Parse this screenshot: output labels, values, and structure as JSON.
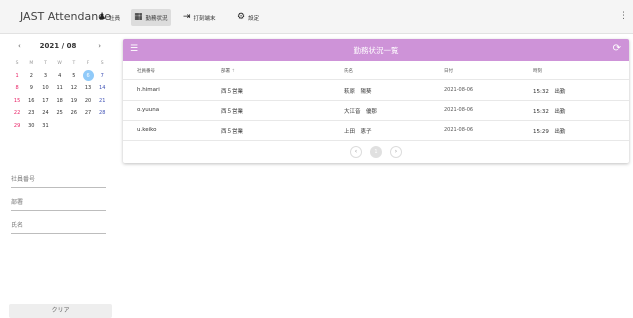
{
  "app": {
    "title": "JAST Attendance"
  },
  "nav": [
    {
      "icon": "users-icon",
      "label": "社員"
    },
    {
      "icon": "calendar-icon",
      "label": "勤務状況"
    },
    {
      "icon": "login-icon",
      "label": "打刻端末"
    },
    {
      "icon": "gear-icon",
      "label": "設定"
    }
  ],
  "calendar": {
    "month_label": "2021 / 08",
    "prev": "‹",
    "next": "›",
    "weekdays": [
      "S",
      "M",
      "T",
      "W",
      "T",
      "F",
      "S"
    ],
    "weeks": [
      [
        "1",
        "2",
        "3",
        "4",
        "5",
        "6",
        "7"
      ],
      [
        "8",
        "9",
        "10",
        "11",
        "12",
        "13",
        "14"
      ],
      [
        "15",
        "16",
        "17",
        "18",
        "19",
        "20",
        "21"
      ],
      [
        "22",
        "23",
        "24",
        "25",
        "26",
        "27",
        "28"
      ],
      [
        "29",
        "30",
        "31",
        "",
        "",
        "",
        ""
      ]
    ],
    "selected_day": "6"
  },
  "filters": {
    "employee_number_label": "社員番号",
    "department_label": "部署",
    "name_label": "氏名",
    "clear_label": "クリア"
  },
  "card": {
    "title": "勤務状況一覧",
    "columns": [
      "社員番号",
      "部署",
      "氏名",
      "日付",
      "時刻"
    ],
    "sort_arrow": "↑",
    "rows": [
      {
        "emp_no": "h.himari",
        "dept": "西５営業",
        "name": "萩原　陽葵",
        "date": "2021-08-06",
        "time": "15:32　出勤"
      },
      {
        "emp_no": "o.yuuna",
        "dept": "西５営業",
        "name": "大江音　優那",
        "date": "2021-08-06",
        "time": "15:32　出勤"
      },
      {
        "emp_no": "u.keiko",
        "dept": "西５営業",
        "name": "上田　恵子",
        "date": "2021-08-06",
        "time": "15:29　出勤"
      }
    ],
    "pager": {
      "prev": "‹",
      "page": "1",
      "next": "›"
    }
  }
}
